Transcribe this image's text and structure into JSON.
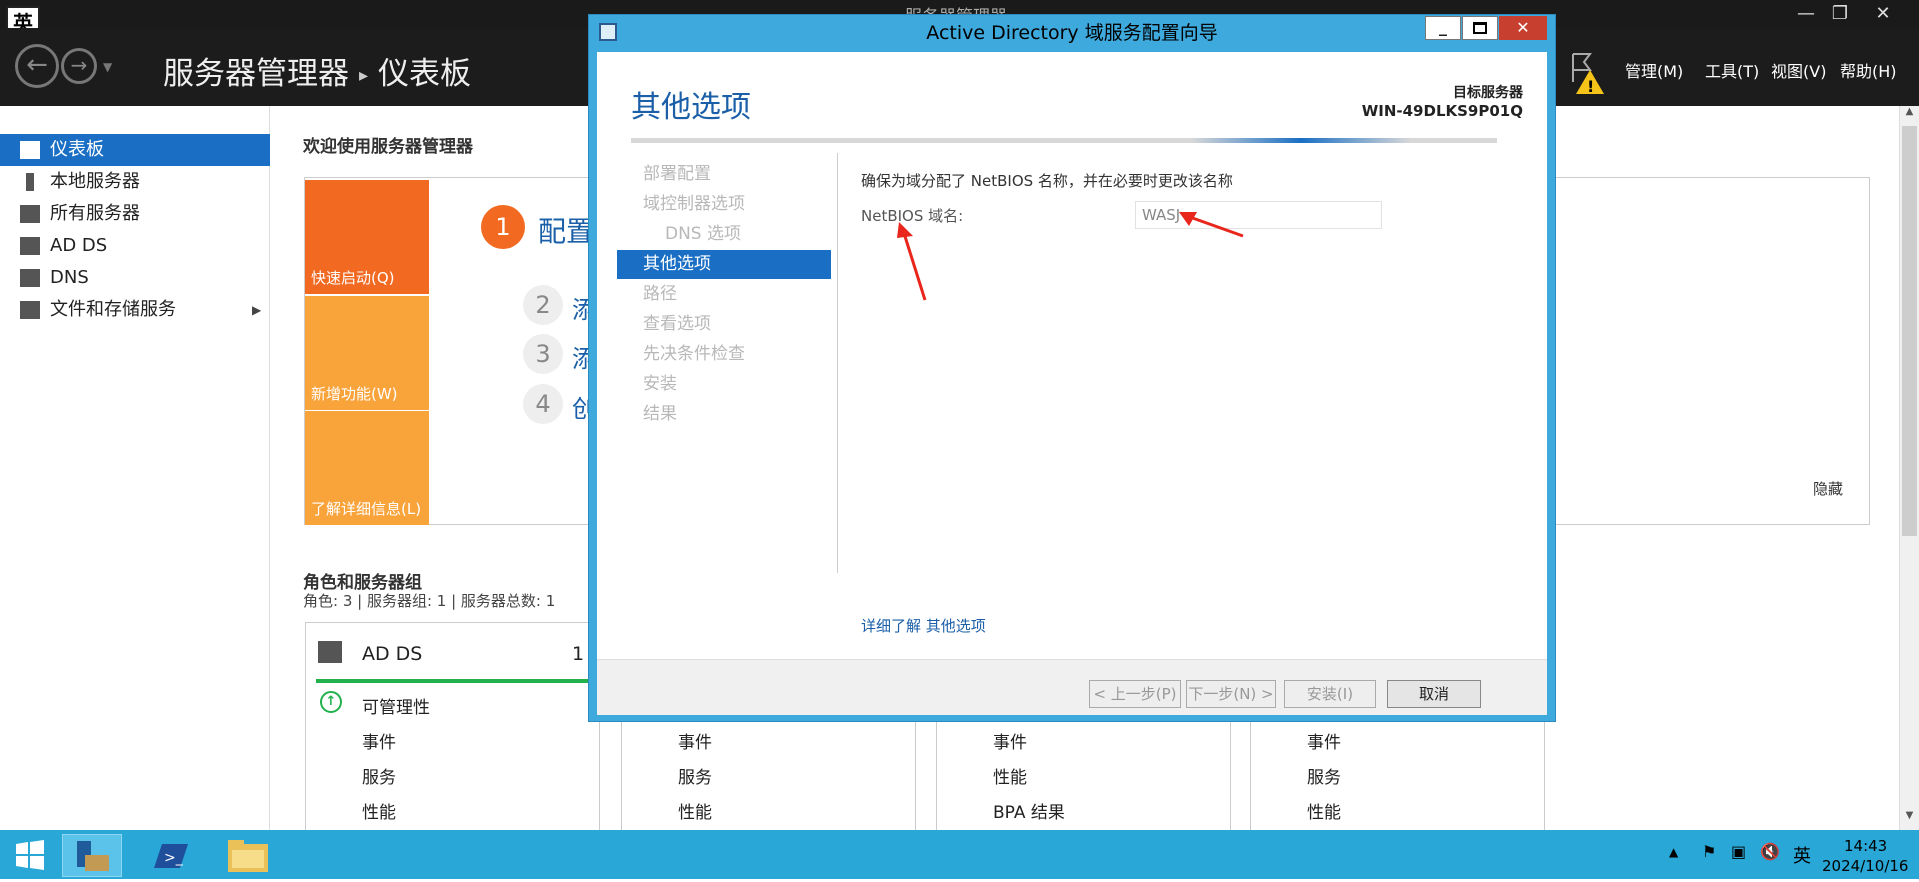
{
  "server_manager": {
    "window_title": "服务器管理器",
    "ime": "英",
    "breadcrumb": {
      "app": "服务器管理器",
      "page": "仪表板"
    },
    "menu": [
      "管理(M)",
      "工具(T)",
      "视图(V)",
      "帮助(H)"
    ],
    "sidebar": [
      {
        "label": "仪表板",
        "active": true,
        "icon": "dashboard-icon"
      },
      {
        "label": "本地服务器",
        "active": false,
        "icon": "server-icon"
      },
      {
        "label": "所有服务器",
        "active": false,
        "icon": "servers-icon"
      },
      {
        "label": "AD DS",
        "active": false,
        "icon": "adds-icon"
      },
      {
        "label": "DNS",
        "active": false,
        "icon": "dns-icon"
      },
      {
        "label": "文件和存储服务",
        "active": false,
        "icon": "storage-icon",
        "has_arrow": true
      }
    ],
    "welcome": "欢迎使用服务器管理器",
    "tiles": [
      {
        "label": "快速启动(Q)",
        "color": "#f26a21"
      },
      {
        "label": "新增功能(W)",
        "color": "#f9a33b"
      },
      {
        "label": "了解详细信息(L)",
        "color": "#f9a33b"
      }
    ],
    "steps": [
      {
        "num": "1",
        "text": "配置"
      },
      {
        "num": "2",
        "text": "添"
      },
      {
        "num": "3",
        "text": "添"
      },
      {
        "num": "4",
        "text": "创"
      }
    ],
    "hide": "隐藏",
    "roles_title": "角色和服务器组",
    "roles_sub": "角色: 3 | 服务器组: 1 | 服务器总数: 1",
    "card1": {
      "name": "AD DS",
      "count": "1",
      "manageability": "可管理性",
      "lines": [
        "事件",
        "服务",
        "性能"
      ]
    },
    "card2": {
      "lines": [
        "事件",
        "服务",
        "性能"
      ]
    },
    "card3": {
      "lines": [
        "事件",
        "性能",
        "BPA 结果"
      ]
    },
    "card4": {
      "lines": [
        "事件",
        "服务",
        "性能"
      ]
    }
  },
  "dialog": {
    "title": "Active Directory 域服务配置向导",
    "heading": "其他选项",
    "target_label": "目标服务器",
    "target_name": "WIN-49DLKS9P01Q",
    "steps": [
      {
        "label": "部署配置",
        "indent": false,
        "active": false
      },
      {
        "label": "域控制器选项",
        "indent": false,
        "active": false
      },
      {
        "label": "DNS 选项",
        "indent": true,
        "active": false
      },
      {
        "label": "其他选项",
        "indent": false,
        "active": true
      },
      {
        "label": "路径",
        "indent": false,
        "active": false
      },
      {
        "label": "查看选项",
        "indent": false,
        "active": false
      },
      {
        "label": "先决条件检查",
        "indent": false,
        "active": false
      },
      {
        "label": "安装",
        "indent": false,
        "active": false
      },
      {
        "label": "结果",
        "indent": false,
        "active": false
      }
    ],
    "description": "确保为域分配了 NetBIOS 名称，并在必要时更改该名称",
    "netbios_label": "NetBIOS 域名:",
    "netbios_value": "WASJ",
    "learn_more": "详细了解 其他选项",
    "buttons": {
      "prev": "< 上一步(P)",
      "next": "下一步(N) >",
      "install": "安装(I)",
      "cancel": "取消"
    }
  },
  "taskbar": {
    "time": "14:43",
    "date": "2024/10/16",
    "ime": "英"
  },
  "colors": {
    "accent": "#1a6fc4",
    "dialog_frame": "#3ea9dc",
    "taskbar": "#29a7d6",
    "orange": "#f26a21",
    "annotation": "#e8261c"
  }
}
